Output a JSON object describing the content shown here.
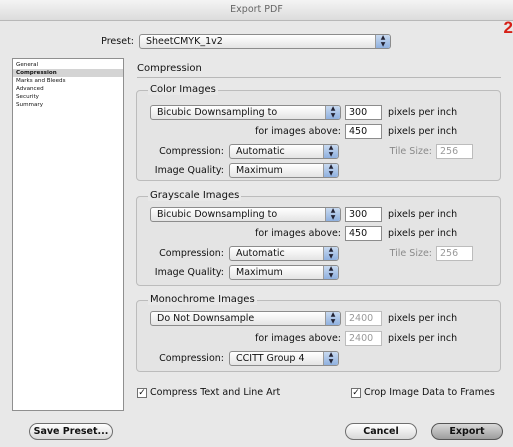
{
  "window": {
    "title": "Export PDF"
  },
  "page_number": "2",
  "preset": {
    "label": "Preset:",
    "value": "SheetCMYK_1v2"
  },
  "sidebar": {
    "items": [
      {
        "label": "General"
      },
      {
        "label": "Compression"
      },
      {
        "label": "Marks and Bleeds"
      },
      {
        "label": "Advanced"
      },
      {
        "label": "Security"
      },
      {
        "label": "Summary"
      }
    ]
  },
  "section_title": "Compression",
  "color": {
    "title": "Color Images",
    "downsampling": "Bicubic Downsampling to",
    "ppi": "300",
    "ppi_unit": "pixels per inch",
    "above_label": "for images above:",
    "above": "450",
    "above_unit": "pixels per inch",
    "compression_label": "Compression:",
    "compression": "Automatic",
    "tile_label": "Tile Size:",
    "tile": "256",
    "quality_label": "Image Quality:",
    "quality": "Maximum"
  },
  "gray": {
    "title": "Grayscale Images",
    "downsampling": "Bicubic Downsampling to",
    "ppi": "300",
    "ppi_unit": "pixels per inch",
    "above_label": "for images above:",
    "above": "450",
    "above_unit": "pixels per inch",
    "compression_label": "Compression:",
    "compression": "Automatic",
    "tile_label": "Tile Size:",
    "tile": "256",
    "quality_label": "Image Quality:",
    "quality": "Maximum"
  },
  "mono": {
    "title": "Monochrome Images",
    "downsampling": "Do Not Downsample",
    "ppi": "2400",
    "ppi_unit": "pixels per inch",
    "above_label": "for images above:",
    "above": "2400",
    "above_unit": "pixels per inch",
    "compression_label": "Compression:",
    "compression": "CCITT Group 4"
  },
  "options": {
    "compress_text": {
      "label": "Compress Text and Line Art",
      "checked": true,
      "mark": "✓"
    },
    "crop_frames": {
      "label": "Crop Image Data to Frames",
      "checked": true,
      "mark": "✓"
    }
  },
  "buttons": {
    "save_preset": "Save Preset...",
    "cancel": "Cancel",
    "export": "Export"
  },
  "icons": {
    "popup_arrows": "up-down-arrows-icon",
    "up": "▲",
    "down": "▼"
  },
  "colors": {
    "page_number": "#d62017",
    "popup_arrow": "#8fb0df"
  }
}
